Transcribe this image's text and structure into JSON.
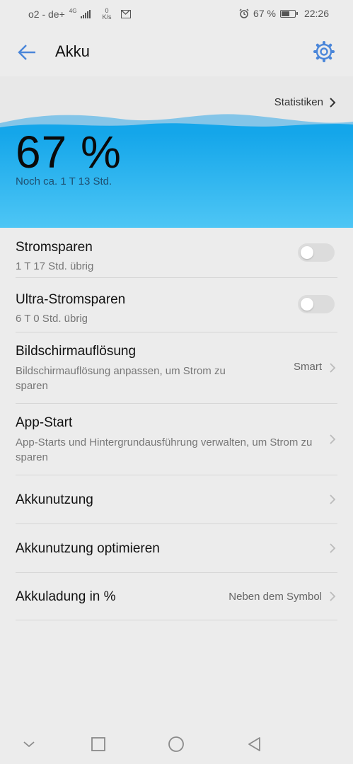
{
  "status": {
    "carrier": "o2 - de+",
    "network_type": "4G",
    "speed_value": "0",
    "speed_unit": "K/s",
    "battery_text": "67 %",
    "battery_level": 0.67,
    "time": "22:26"
  },
  "appbar": {
    "title": "Akku",
    "back_icon": "arrow-left-icon",
    "settings_icon": "gear-icon"
  },
  "battery": {
    "statistics_label": "Statistiken",
    "percent": "67 %",
    "remaining": "Noch ca. 1 T 13 Std."
  },
  "settings": {
    "power_saving": {
      "title": "Stromsparen",
      "subtitle": "1 T 17 Std. übrig",
      "enabled": false
    },
    "ultra_power_saving": {
      "title": "Ultra-Stromsparen",
      "subtitle": "6 T 0 Std. übrig",
      "enabled": false
    },
    "screen_resolution": {
      "title": "Bildschirmauflösung",
      "subtitle": "Bildschirmauflösung anpassen, um Strom zu sparen",
      "value": "Smart"
    },
    "app_start": {
      "title": "App-Start",
      "subtitle": "App-Starts und Hintergrundausführung verwalten, um Strom zu sparen"
    },
    "battery_usage": {
      "title": "Akkunutzung"
    },
    "optimize": {
      "title": "Akkunutzung optimieren"
    },
    "percentage": {
      "title": "Akkuladung in %",
      "value": "Neben dem Symbol"
    }
  },
  "colors": {
    "accent": "#4a86d9",
    "wave_blue": "#14a6ea"
  },
  "navbar": {
    "icons": [
      "chevron-down-icon",
      "recent-apps-icon",
      "home-icon",
      "back-triangle-icon"
    ]
  }
}
